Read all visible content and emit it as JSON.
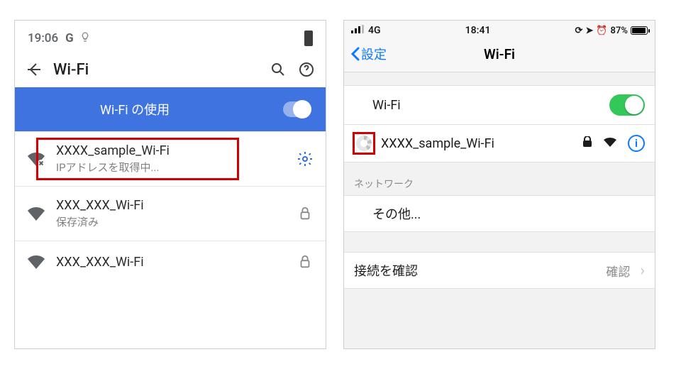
{
  "android": {
    "status": {
      "time": "19:06",
      "g": "G",
      "bulb": "💡"
    },
    "appbar": {
      "title": "Wi-Fi"
    },
    "toggle": {
      "label": "Wi-Fi の使用",
      "on": true
    },
    "networks": [
      {
        "ssid": "XXXX_sample_Wi-Fi",
        "sub": "IPアドレスを取得中...",
        "trailing": "gear",
        "highlighted": true
      },
      {
        "ssid": "XXX_XXX_Wi-Fi",
        "sub": "保存済み",
        "trailing": "lock"
      },
      {
        "ssid": "XXX_XXX_Wi-Fi",
        "sub": "",
        "trailing": "lock"
      }
    ]
  },
  "ios": {
    "status": {
      "carrier": "4G",
      "time": "18:41",
      "battery_pct": "87%",
      "icons": "◎ ▹ ⏰"
    },
    "nav": {
      "back": "設定",
      "title": "Wi-Fi"
    },
    "wifi_row": {
      "label": "Wi-Fi",
      "on": true
    },
    "connected": {
      "ssid": "XXXX_sample_Wi-Fi",
      "secure": true,
      "highlighted": true
    },
    "section_header": "ネットワーク",
    "other": "その他...",
    "ask_row": {
      "label": "接続を確認",
      "value": "確認"
    }
  }
}
